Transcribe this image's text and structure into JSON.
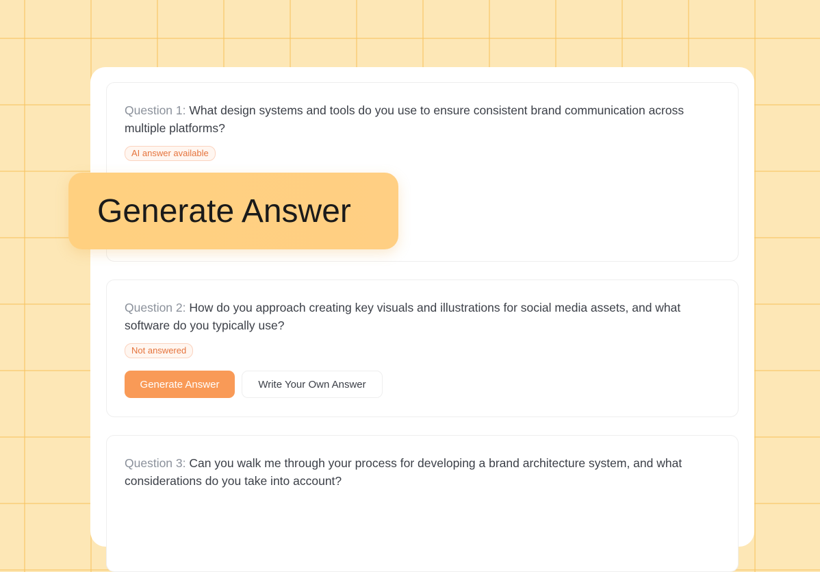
{
  "questions": [
    {
      "prefix": "Question 1:",
      "text": "What design systems and tools do you use to ensure consistent brand communication across multiple platforms?",
      "status": "AI answer available"
    },
    {
      "prefix": "Question 2:",
      "text": "How do you approach creating key visuals and illustrations for social media assets, and what software do you typically use?",
      "status": "Not answered",
      "primary_action": "Generate Answer",
      "secondary_action": "Write Your Own Answer"
    },
    {
      "prefix": "Question 3:",
      "text": "Can you walk me through your process for developing a brand architecture system, and what considerations do you take into account?"
    }
  ],
  "callout": {
    "label": "Generate Answer"
  },
  "colors": {
    "accent": "#f99a57",
    "badge_text": "#e5743d",
    "background": "#fde7b6",
    "callout": "#ffd080"
  }
}
